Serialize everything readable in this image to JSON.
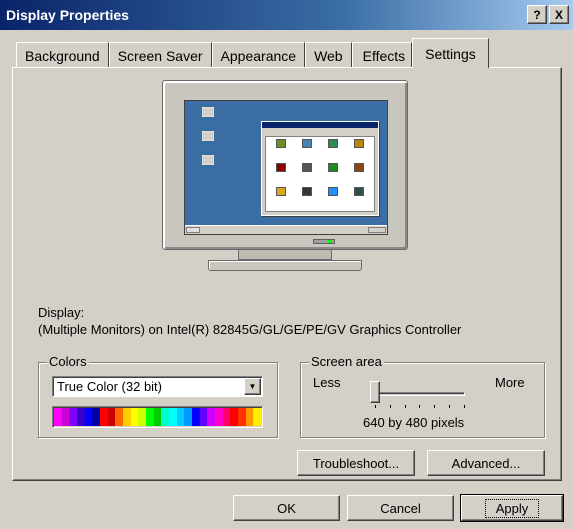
{
  "window": {
    "title": "Display Properties",
    "help_btn": "?",
    "close_btn": "X"
  },
  "tabs": [
    {
      "label": "Background"
    },
    {
      "label": "Screen Saver"
    },
    {
      "label": "Appearance"
    },
    {
      "label": "Web"
    },
    {
      "label": "Effects"
    },
    {
      "label": "Settings",
      "active": true
    }
  ],
  "display": {
    "label": "Display:",
    "value": "(Multiple Monitors) on Intel(R) 82845G/GL/GE/PE/GV Graphics Controller"
  },
  "colors": {
    "legend": "Colors",
    "selected": "True Color (32 bit)"
  },
  "screen_area": {
    "legend": "Screen area",
    "less": "Less",
    "more": "More",
    "resolution": "640 by 480 pixels",
    "slider_position": 0
  },
  "buttons": {
    "troubleshoot": "Troubleshoot...",
    "advanced": "Advanced...",
    "ok": "OK",
    "cancel": "Cancel",
    "apply": "Apply"
  }
}
